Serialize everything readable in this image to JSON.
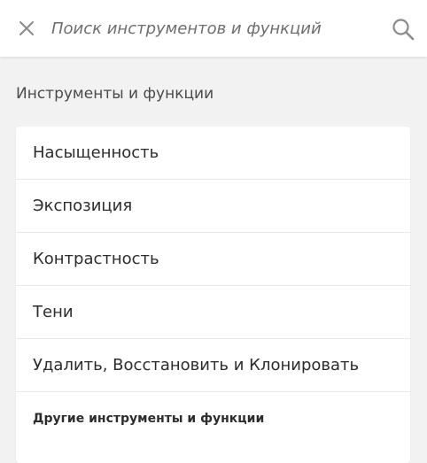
{
  "search": {
    "placeholder": "Поиск инструментов и функций",
    "value": ""
  },
  "icons": {
    "close": "close-icon",
    "search": "search-icon"
  },
  "section": {
    "title": "Инструменты и функции"
  },
  "list": {
    "items": [
      {
        "label": "Насыщенность"
      },
      {
        "label": "Экспозиция"
      },
      {
        "label": "Контрастность"
      },
      {
        "label": "Тени"
      },
      {
        "label": "Удалить, Восстановить и Клонировать"
      }
    ],
    "footer": "Другие инструменты и функции"
  },
  "colors": {
    "background": "#f2f2f2",
    "surface": "#ffffff",
    "text": "#2c2c2c",
    "icon": "#8a8a8a",
    "divider": "#e6e6e6"
  }
}
